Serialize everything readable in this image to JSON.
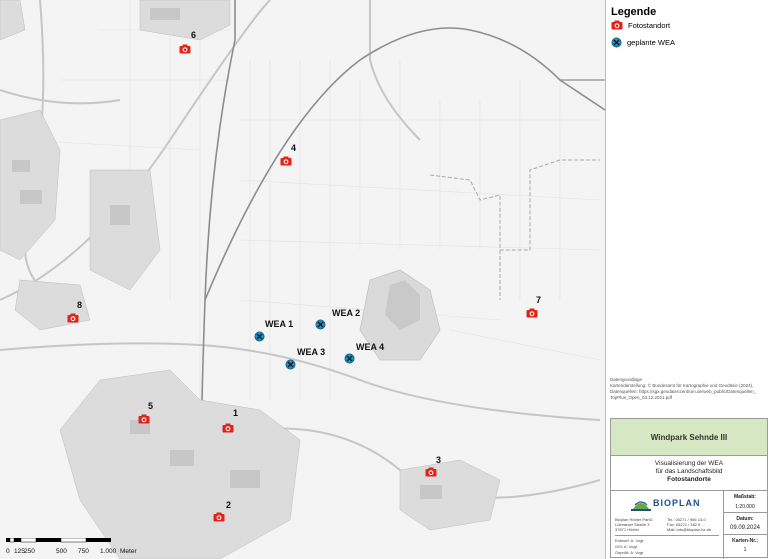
{
  "legend": {
    "title": "Legende",
    "items": [
      {
        "label": "Fotostandort",
        "icon": "camera-icon",
        "color": "#e2231a"
      },
      {
        "label": "geplante WEA",
        "icon": "turbine-icon",
        "color": "#1c8fbf"
      }
    ]
  },
  "photo_points": [
    {
      "label": "1"
    },
    {
      "label": "2"
    },
    {
      "label": "3"
    },
    {
      "label": "4"
    },
    {
      "label": "5"
    },
    {
      "label": "6"
    },
    {
      "label": "7"
    },
    {
      "label": "8"
    }
  ],
  "turbines": [
    {
      "label": "WEA 1"
    },
    {
      "label": "WEA 2"
    },
    {
      "label": "WEA 3"
    },
    {
      "label": "WEA 4"
    }
  ],
  "scale": {
    "ticks": [
      "0",
      "125",
      "250",
      "500",
      "750",
      "1.000"
    ],
    "unit": "Meter"
  },
  "source_text": {
    "line1": "Datengrundlage",
    "line2": "Kartendarstellung: © Bundesamt für Kartographie und Geodäsie (2024),",
    "line3": "Datenquellen: https://sgx.geodatenzentrum.de/web_public/Datenquellen_",
    "line4": "TopPlus_Open_03.12.2021.pdf"
  },
  "title_block": {
    "project": "Windpark Sehnde III",
    "desc1": "Visualisierung der WEA",
    "desc2": "für das Landschaftsbild",
    "desc3": "Fotostandorte",
    "company": "BIOPLAN",
    "address1": "Bioplan Höxter PartG",
    "address2": "Lütmarser Straße 3",
    "address3": "37671 Höxter",
    "phone": "Tel.: 05271 / 966 13-0",
    "fax": "Fax: 05271 / 182 6 ...",
    "mail": "Mail: info@bioplan-hx.de",
    "massstab_label": "Maßstab:",
    "massstab_value": "1:20.000",
    "datum_label": "Datum:",
    "datum_value": "09.09.2024",
    "karten_label": "Karten-Nr.:",
    "karten_value": "1",
    "bearb": "Entwurf:",
    "gis": "GIS:",
    "gepr": "Geprüft:",
    "bearb_v": "A. Vogt",
    "gis_v": "A. Vogt",
    "gepr_v": "A. Vogt"
  },
  "colors": {
    "camera": "#e2231a",
    "turbine": "#1c8fbf",
    "title_bar": "#d6e8c3",
    "logo_blue": "#1b4f91",
    "logo_green": "#6aa83c"
  }
}
